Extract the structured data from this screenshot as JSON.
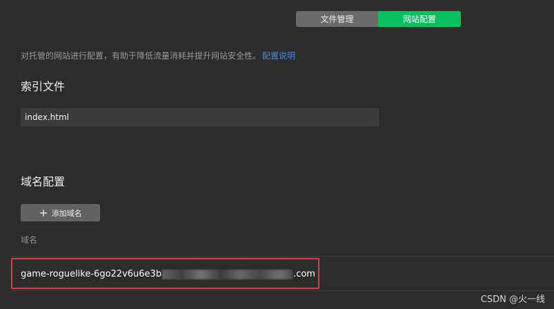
{
  "tabs": [
    {
      "label": "文件管理",
      "active": false
    },
    {
      "label": "网站配置",
      "active": true
    }
  ],
  "description": {
    "text": "对托管的网站进行配置，有助于降低流量消耗并提升网站安全性。",
    "link": "配置说明"
  },
  "index_section": {
    "title": "索引文件",
    "value": "index.html"
  },
  "domain_section": {
    "title": "域名配置",
    "add_button": "添加域名",
    "column_header": "域名",
    "rows": [
      {
        "prefix": "game-roguelike-6go22v6u6e3b",
        "suffix": ".com"
      }
    ]
  },
  "watermark": "CSDN @火一线",
  "colors": {
    "background": "#2c2c2c",
    "accent": "#07c160",
    "link": "#3f8fea",
    "highlight": "#e43b3b"
  }
}
